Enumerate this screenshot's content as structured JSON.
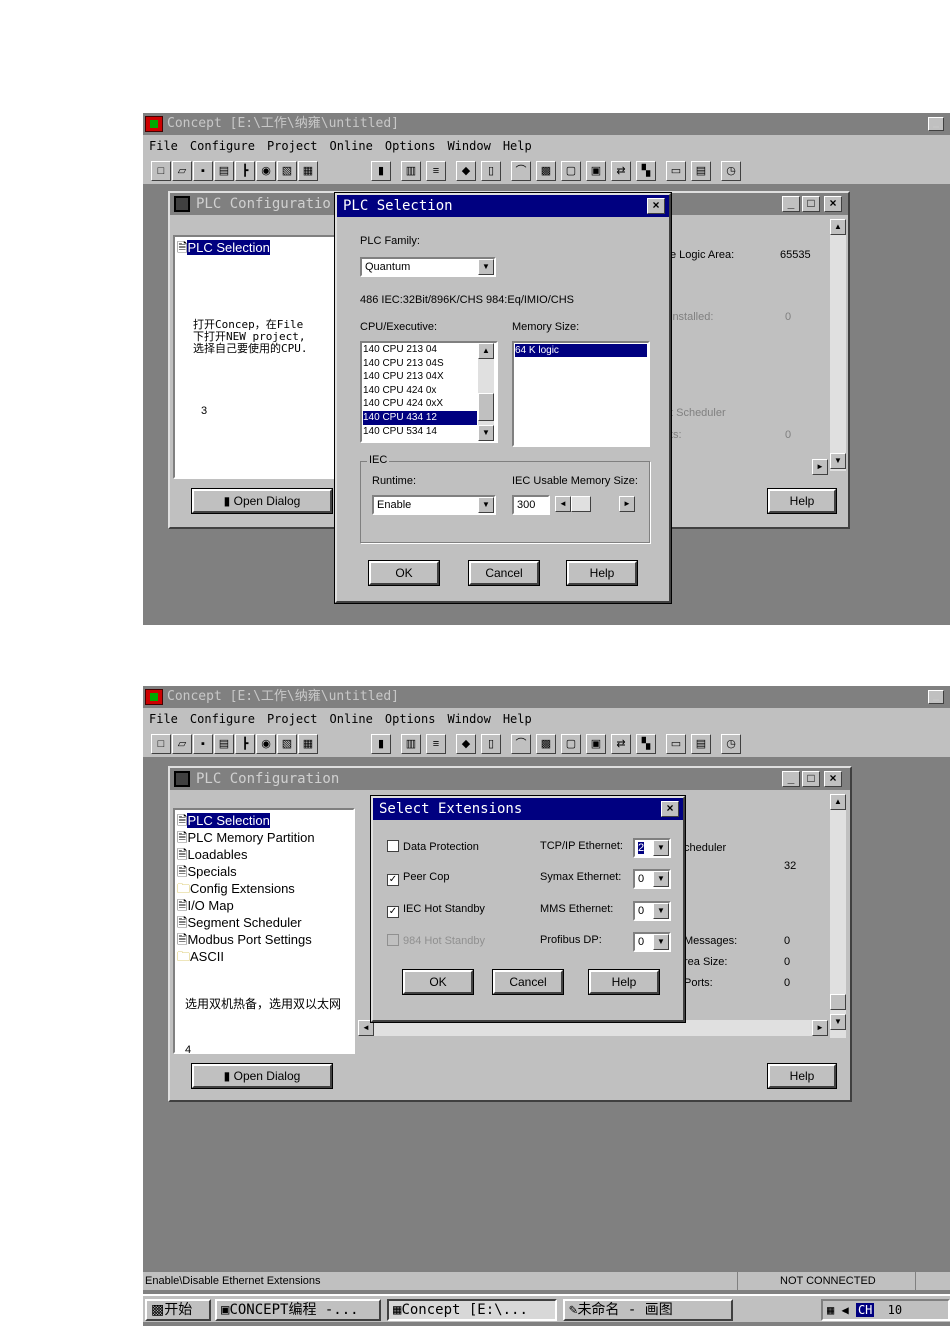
{
  "app": {
    "title": "Concept [E:\\工作\\纳雍\\untitled]",
    "min": "_",
    "menu": [
      "File",
      "Configure",
      "Project",
      "Online",
      "Options",
      "Window",
      "Help"
    ]
  },
  "plc_config": {
    "title": "PLC Configuration",
    "title_truncated": "PLC Configuratio",
    "selected_item": "PLC Selection",
    "open_dialog": "Open Dialog",
    "help": "Help",
    "tree": [
      "PLC Selection",
      "PLC Memory Partition",
      "Loadables",
      "Specials",
      "Config Extensions",
      "I/O Map",
      "Segment Scheduler",
      "Modbus Port Settings",
      "ASCII"
    ],
    "right1": {
      "logic_area_label": "e Logic Area:",
      "logic_area_value": "65535",
      "installed_label": "installed:",
      "installed_value": "0",
      "scheduler_label": "t Scheduler",
      "ts_label": "ts:",
      "ts_value": "0"
    },
    "right2": {
      "scheduler_label": "cheduler",
      "scheduler_value": "32",
      "messages_label": "Messages:",
      "messages_value": "0",
      "area_label": "rea Size:",
      "area_value": "0",
      "ports_label": "Ports:",
      "ports_value": "0"
    }
  },
  "annotation1": {
    "text": "打开Concep，在File下打开NEW project, 选择自己要使用的CPU.",
    "number": "3"
  },
  "annotation2": {
    "text": "选用双机热备，选用双以太网",
    "number": "4"
  },
  "plc_selection": {
    "title": "PLC Selection",
    "family_label": "PLC Family:",
    "family_value": "Quantum",
    "description": "486 IEC:32Bit/896K/CHS 984:Eq/IMIO/CHS",
    "cpu_label": "CPU/Executive:",
    "cpu_list": [
      "140 CPU 213 04",
      "140 CPU 213 04S",
      "140 CPU 213 04X",
      "140 CPU 424 0x",
      "140 CPU 424 0xX",
      "140 CPU 434 12",
      "140 CPU 534 14"
    ],
    "cpu_selected": "140 CPU 434 12",
    "memory_label": "Memory Size:",
    "memory_value": "64 K logic",
    "iec_group": "IEC",
    "runtime_label": "Runtime:",
    "runtime_value": "Enable",
    "iec_mem_label": "IEC Usable Memory Size:",
    "iec_mem_value": "300",
    "ok": "OK",
    "cancel": "Cancel",
    "help": "Help"
  },
  "select_ext": {
    "title": "Select Extensions",
    "data_protection": "Data Protection",
    "peer_cop": "Peer Cop",
    "iec_hot_standby": "IEC Hot Standby",
    "hot_standby_984": "984 Hot Standby",
    "tcpip_label": "TCP/IP Ethernet:",
    "tcpip_value": "2",
    "symax_label": "Symax Ethernet:",
    "symax_value": "0",
    "mms_label": "MMS Ethernet:",
    "mms_value": "0",
    "profibus_label": "Profibus DP:",
    "profibus_value": "0",
    "check_mark": "✓",
    "ok": "OK",
    "cancel": "Cancel",
    "help": "Help"
  },
  "status": {
    "left": "Enable\\Disable Ethernet Extensions",
    "right": "NOT CONNECTED"
  },
  "taskbar": {
    "start": "开始",
    "item1": "CONCEPT编程 -...",
    "item2": "Concept [E:\\...",
    "item3": "未命名 - 画图",
    "lang": "CH",
    "clock": "10"
  }
}
